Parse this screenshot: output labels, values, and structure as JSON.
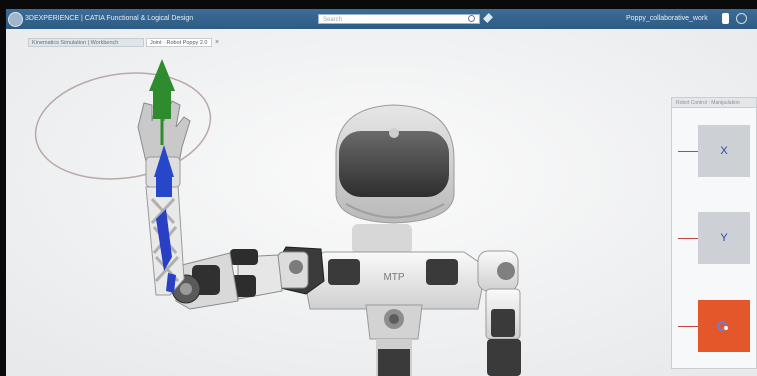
{
  "titlebar": {
    "app_title": "3DEXPERIENCE | CATIA Functional & Logical Design",
    "search_placeholder": "Search",
    "user_name": "Poppy_collaborative_work"
  },
  "tabs": [
    {
      "label": "Kinematics Simulation | Workbench"
    },
    {
      "label": "Joint · Robot Poppy 2.0"
    }
  ],
  "panel": {
    "title": "Robot Control · Manipulation",
    "axis_x_label": "X",
    "axis_y_label": "Y",
    "axis_z_label": ""
  },
  "robot": {
    "chest_text": "MTP"
  },
  "colors": {
    "titlebar": "#2f5f8a",
    "accent_active": "#e4572a",
    "manipulator_green": "#2e8b2e",
    "manipulator_blue": "#2647c8"
  }
}
